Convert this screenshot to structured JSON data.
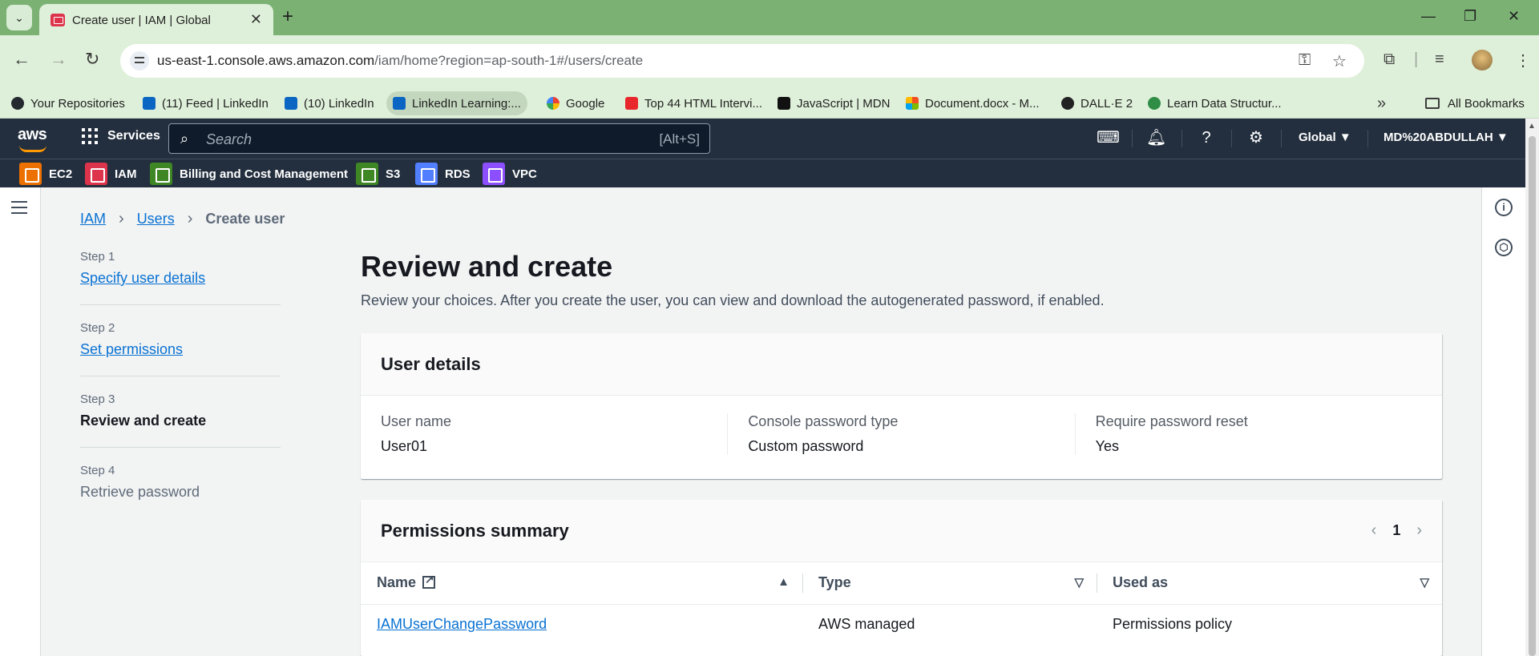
{
  "browser": {
    "tab_title": "Create user | IAM | Global",
    "url_host": "us-east-1.console.aws.amazon.com",
    "url_path": "/iam/home?region=ap-south-1#/users/create",
    "bookmarks": [
      "Your Repositories",
      "(11) Feed | LinkedIn",
      "(10) LinkedIn",
      "LinkedIn Learning:...",
      "Google",
      "Top 44 HTML Intervi...",
      "JavaScript | MDN",
      "Document.docx - M...",
      "DALL·E 2",
      "Learn Data Structur..."
    ],
    "all_bookmarks": "All Bookmarks"
  },
  "aws_header": {
    "logo": "aws",
    "services": "Services",
    "search_placeholder": "Search",
    "search_shortcut": "[Alt+S]",
    "region": "Global ▼",
    "account": "MD%20ABDULLAH ▼",
    "favorites": [
      {
        "label": "EC2",
        "color": "#ed7100"
      },
      {
        "label": "IAM",
        "color": "#dd344c"
      },
      {
        "label": "Billing and Cost Management",
        "color": "#3f8624"
      },
      {
        "label": "S3",
        "color": "#3f8624"
      },
      {
        "label": "RDS",
        "color": "#527fff"
      },
      {
        "label": "VPC",
        "color": "#8c4fff"
      }
    ]
  },
  "breadcrumb": {
    "iam": "IAM",
    "users": "Users",
    "current": "Create user"
  },
  "steps": [
    {
      "num": "Step 1",
      "label": "Specify user details",
      "state": "link"
    },
    {
      "num": "Step 2",
      "label": "Set permissions",
      "state": "link"
    },
    {
      "num": "Step 3",
      "label": "Review and create",
      "state": "current"
    },
    {
      "num": "Step 4",
      "label": "Retrieve password",
      "state": "disabled"
    }
  ],
  "page": {
    "title": "Review and create",
    "description": "Review your choices. After you create the user, you can view and download the autogenerated password, if enabled."
  },
  "user_details": {
    "title": "User details",
    "fields": [
      {
        "label": "User name",
        "value": "User01"
      },
      {
        "label": "Console password type",
        "value": "Custom password"
      },
      {
        "label": "Require password reset",
        "value": "Yes"
      }
    ]
  },
  "permissions": {
    "title": "Permissions summary",
    "page": "1",
    "columns": [
      "Name",
      "Type",
      "Used as"
    ],
    "rows": [
      {
        "name": "IAMUserChangePassword",
        "type": "AWS managed",
        "used_as": "Permissions policy"
      }
    ]
  }
}
